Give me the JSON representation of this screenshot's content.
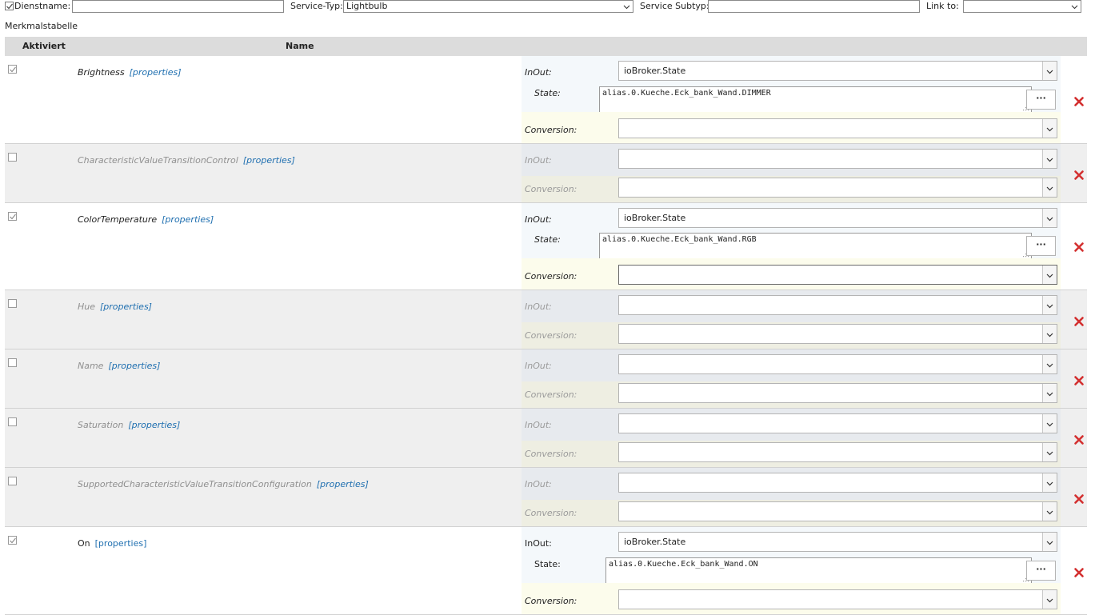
{
  "topbar": {
    "dienstname_label": "Dienstname:",
    "dienstname_checked": true,
    "dienstname_value": "",
    "service_typ_label": "Service-Typ:",
    "service_typ_value": "Lightbulb",
    "service_subtyp_label": "Service Subtyp:",
    "service_subtyp_value": "",
    "link_to_label": "Link to:",
    "link_to_value": ""
  },
  "section_title": "Merkmalstabelle",
  "table": {
    "col_aktiviert": "Aktiviert",
    "col_name": "Name"
  },
  "common": {
    "properties_link": "[properties]",
    "inout_label": "InOut:",
    "state_label": "State:",
    "conversion_label": "Conversion:",
    "browse_button": "···"
  },
  "rows": [
    {
      "name": "Brightness",
      "active": true,
      "inout": "ioBroker.State",
      "state": "alias.0.Kueche.Eck_bank_Wand.DIMMER",
      "conversion": ""
    },
    {
      "name": "CharacteristicValueTransitionControl",
      "active": false,
      "inout": "",
      "conversion": ""
    },
    {
      "name": "ColorTemperature",
      "active": true,
      "inout": "ioBroker.State",
      "state": "alias.0.Kueche.Eck_bank_Wand.RGB",
      "conversion": ""
    },
    {
      "name": "Hue",
      "active": false,
      "inout": "",
      "conversion": ""
    },
    {
      "name": "Name",
      "active": false,
      "inout": "",
      "conversion": ""
    },
    {
      "name": "Saturation",
      "active": false,
      "inout": "",
      "conversion": ""
    },
    {
      "name": "SupportedCharacteristicValueTransitionConfiguration",
      "active": false,
      "inout": "",
      "conversion": ""
    },
    {
      "name": "On",
      "active": true,
      "inout": "ioBroker.State",
      "state": "alias.0.Kueche.Eck_bank_Wand.ON",
      "conversion": ""
    }
  ],
  "colors": {
    "link": "#1f6fb0",
    "delete": "#d32f2f",
    "header_bg": "#dcdcdc",
    "inactive_row_bg": "#efefef"
  },
  "icons": {
    "delete": "delete-x-icon",
    "dropdown": "chevron-down-icon",
    "checkbox": "checkmark-icon",
    "resize": "resize-grip-icon"
  }
}
